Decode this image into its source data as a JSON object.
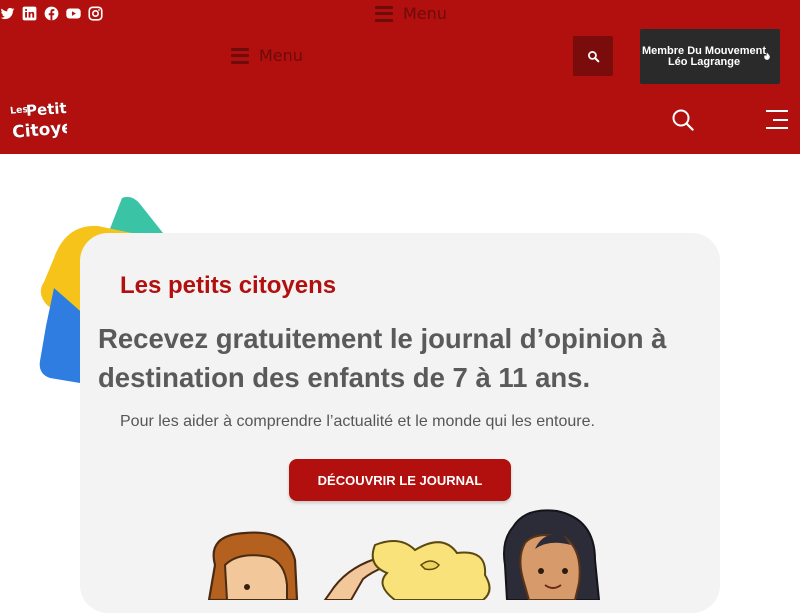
{
  "colors": {
    "header_red": "#b1100f",
    "dark_red": "#7a0c0b",
    "menu_text": "#6e0b0b",
    "badge_dark": "#2a2a2a",
    "card_bg": "#f3f3f3",
    "deco_teal": "#3ac3a5",
    "deco_yellow": "#f6c31a",
    "deco_blue": "#2f7de0"
  },
  "header": {
    "social_icons": [
      "twitter-icon",
      "linkedin-icon",
      "facebook-icon",
      "youtube-icon",
      "instagram-icon"
    ],
    "menu_top_label": "Menu",
    "menu_label": "Menu",
    "membre_label": "Membre Du Mouvement Léo Lagrange"
  },
  "hero": {
    "title": "Les petits citoyens",
    "headline": "Recevez gratuitement le journal d’opinion à destination des enfants de 7 à 11 ans.",
    "subtitle": "Pour les aider à comprendre l’actualité et le monde qui les entoure.",
    "cta_label": "DÉCOUVRIR LE JOURNAL"
  }
}
